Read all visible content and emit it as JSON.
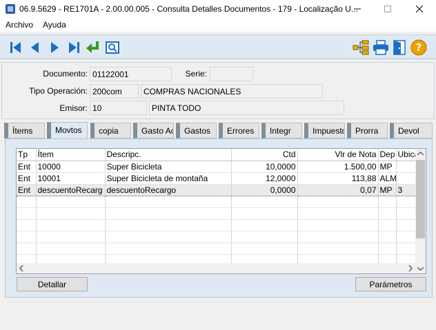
{
  "window": {
    "title": "06.9.5629 - RE1701A - 2.00.00.005 - Consulta Detalles Documentos - 179 - Localização U...",
    "icons": {
      "app": "app-icon",
      "minimize": "minimize-icon",
      "maximize": "maximize-icon",
      "close": "close-icon"
    }
  },
  "menu": {
    "items": [
      "Archivo",
      "Ayuda"
    ]
  },
  "toolbar": {
    "left": [
      "first-record-icon",
      "previous-record-icon",
      "next-record-icon",
      "last-record-icon",
      "return-icon",
      "zoom-icon"
    ],
    "right": [
      "hierarchy-icon",
      "print-icon",
      "exit-icon",
      "help-icon"
    ]
  },
  "header": {
    "documento_label": "Documento:",
    "documento_value": "01122001",
    "serie_label": "Serie:",
    "serie_value": "",
    "tipo_label": "Tipo Operación:",
    "tipo_code": "200com",
    "tipo_desc": "COMPRAS NACIONALES",
    "emisor_label": "Emisor:",
    "emisor_code": "10",
    "emisor_name": "PINTA TODO"
  },
  "tabs": [
    "Ítems",
    "Movtos",
    "copia",
    "Gasto Acc",
    "Gastos",
    "Errores",
    "Integr",
    "Impuesto",
    "Prorra",
    "Devol"
  ],
  "active_tab": "Movtos",
  "grid": {
    "columns": [
      "Tp",
      "Ítem",
      "Descripc.",
      "Ctd",
      "Vlr de Nota",
      "Dep",
      "Ubica"
    ],
    "rows": [
      [
        "Ent",
        "10000",
        "Super Bicicleta",
        "10,0000",
        "1.500,00",
        "MP",
        ""
      ],
      [
        "Ent",
        "10001",
        "Super Bicicleta de montaña",
        "12,0000",
        "113,88",
        "ALM",
        ""
      ],
      [
        "Ent",
        "descuentoRecarg",
        "descuentoRecargo",
        "0,0000",
        "0,07",
        "MP",
        "3"
      ]
    ],
    "selected_row": 2,
    "empty_rows": 6
  },
  "buttons": {
    "detallar": "Detallar",
    "parametros": "Parámetros"
  },
  "colors": {
    "toolbar_bg": "#dfe9f3",
    "panel_bg": "#dfe9f3",
    "accent_blue": "#1a6fc4",
    "green_return": "#3a9a1a",
    "help_orange": "#f0a000"
  }
}
